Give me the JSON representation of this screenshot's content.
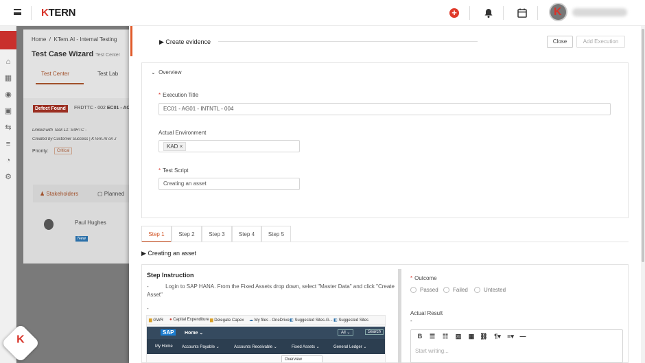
{
  "topbar": {
    "logo_prefix": "K",
    "logo_rest": "TERN",
    "plus": "+"
  },
  "background": {
    "breadcrumb_home": "Home",
    "breadcrumb_sep": "/",
    "breadcrumb_project": "KTern.AI - Internal Testing",
    "page_title": "Test Case Wizard",
    "page_subtitle": "Test Center",
    "tab_test_center": "Test Center",
    "tab_test_lab": "Test Lab",
    "defect_badge": "Defect Found",
    "test_code": "FRDTTC - 002",
    "test_title": "EC01 - AC",
    "linked_with": "Linked with Task L1: S4HTC -",
    "created_by": "Created by Customer Success | KTern.AI on J",
    "priority_label": "Priority:",
    "priority_value": "Critical",
    "tab_stakeholders": "Stakeholders",
    "tab_planned": "Planned",
    "stakeholder_name": "Paul Hughes",
    "stakeholder_badge": "New"
  },
  "panel": {
    "title": "Create evidence",
    "close_button": "Close",
    "add_execution_button": "Add Execution",
    "overview_label": "Overview",
    "execution_title_label": "Execution Title",
    "execution_title_value": "EC01 - AG01 - INTNTL - 004",
    "environment_label": "Actual Environment",
    "environment_tag": "KAD",
    "test_script_label": "Test Script",
    "test_script_value": "Creating an asset",
    "steps": [
      "Step 1",
      "Step 2",
      "Step 3",
      "Step 4",
      "Step 5"
    ],
    "active_step": 0,
    "step_heading": "Creating an asset",
    "step_instruction_label": "Step Instruction",
    "step_instruction_text_line1": "-           Login to SAP HANA. From the Fixed Assets drop down, select \"Master Data\" and click \"Create",
    "step_instruction_text_line2": "Asset\"",
    "step_dash": "-",
    "outcome_label": "Outcome",
    "outcomes": [
      "Passed",
      "Failed",
      "Untested"
    ],
    "actual_result_label": "Actual Result",
    "actual_result_dash": "-",
    "editor_placeholder": "Start writing...",
    "required_mark": "*"
  },
  "sap_screenshot": {
    "favorites": [
      "GWR",
      "Capital Expenditure",
      "Delegate Capex",
      "My files - OneDrive",
      "Suggested Sites-G...",
      "Suggested Sites"
    ],
    "logo": "SAP",
    "home_label": "Home",
    "search_scope": "All",
    "search_label": "Search",
    "menu": [
      "My Home",
      "Accounts Payable",
      "Accounts Receivable",
      "Fixed Assets",
      "General Ledger"
    ],
    "dropdown_item": "Overview"
  },
  "colors": {
    "accent": "#d8342a",
    "tab_active": "#d05020"
  }
}
